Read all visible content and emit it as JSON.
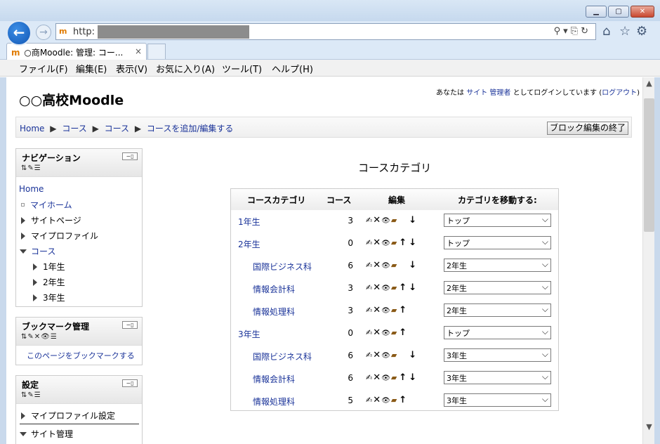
{
  "browser": {
    "url_prefix": "http:",
    "tab_title": "○商Moodle: 管理: コー...",
    "tab_close": "×",
    "menu": [
      "ファイル(F)",
      "編集(E)",
      "表示(V)",
      "お気に入り(A)",
      "ツール(T)",
      "ヘルプ(H)"
    ]
  },
  "site": {
    "title": "○○高校Moodle",
    "login_prefix": "あなたは",
    "login_user": "サイト 管理者",
    "login_mid": "としてログインしています (",
    "logout": "ログアウト",
    "login_suffix": ")"
  },
  "breadcrumb": {
    "items": [
      "Home",
      "コース",
      "コース",
      "コースを追加/編集する"
    ],
    "separator": "▶"
  },
  "edit_blocks_button": "ブロック編集の終了",
  "navigation_block": {
    "title": "ナビゲーション",
    "home": "Home",
    "my_home": "マイホーム",
    "site_pages": "サイトページ",
    "my_profile": "マイプロファイル",
    "courses": "コース",
    "years": [
      "1年生",
      "2年生",
      "3年生"
    ]
  },
  "bookmark_block": {
    "title": "ブックマーク管理",
    "link": "このページをブックマークする"
  },
  "settings_block": {
    "title": "設定",
    "my_profile_settings": "マイプロファイル設定",
    "site_admin": "サイト管理"
  },
  "category_heading": "コースカテゴリ",
  "category_table": {
    "headers": [
      "コースカテゴリ",
      "コース",
      "編集",
      "カテゴリを移動する:"
    ],
    "rows": [
      {
        "name": "1年生",
        "count": "3",
        "up": false,
        "down": true,
        "move_to": "トップ",
        "indent": false
      },
      {
        "name": "2年生",
        "count": "0",
        "up": true,
        "down": true,
        "move_to": "トップ",
        "indent": false
      },
      {
        "name": "国際ビジネス科",
        "count": "6",
        "up": false,
        "down": true,
        "move_to": "2年生",
        "indent": true
      },
      {
        "name": "情報会計科",
        "count": "3",
        "up": true,
        "down": true,
        "move_to": "2年生",
        "indent": true
      },
      {
        "name": "情報処理科",
        "count": "3",
        "up": true,
        "down": false,
        "move_to": "2年生",
        "indent": true
      },
      {
        "name": "3年生",
        "count": "0",
        "up": true,
        "down": false,
        "move_to": "トップ",
        "indent": false
      },
      {
        "name": "国際ビジネス科",
        "count": "6",
        "up": false,
        "down": true,
        "move_to": "3年生",
        "indent": true
      },
      {
        "name": "情報会計科",
        "count": "6",
        "up": true,
        "down": true,
        "move_to": "3年生",
        "indent": true
      },
      {
        "name": "情報処理科",
        "count": "5",
        "up": true,
        "down": false,
        "move_to": "3年生",
        "indent": true
      }
    ]
  }
}
